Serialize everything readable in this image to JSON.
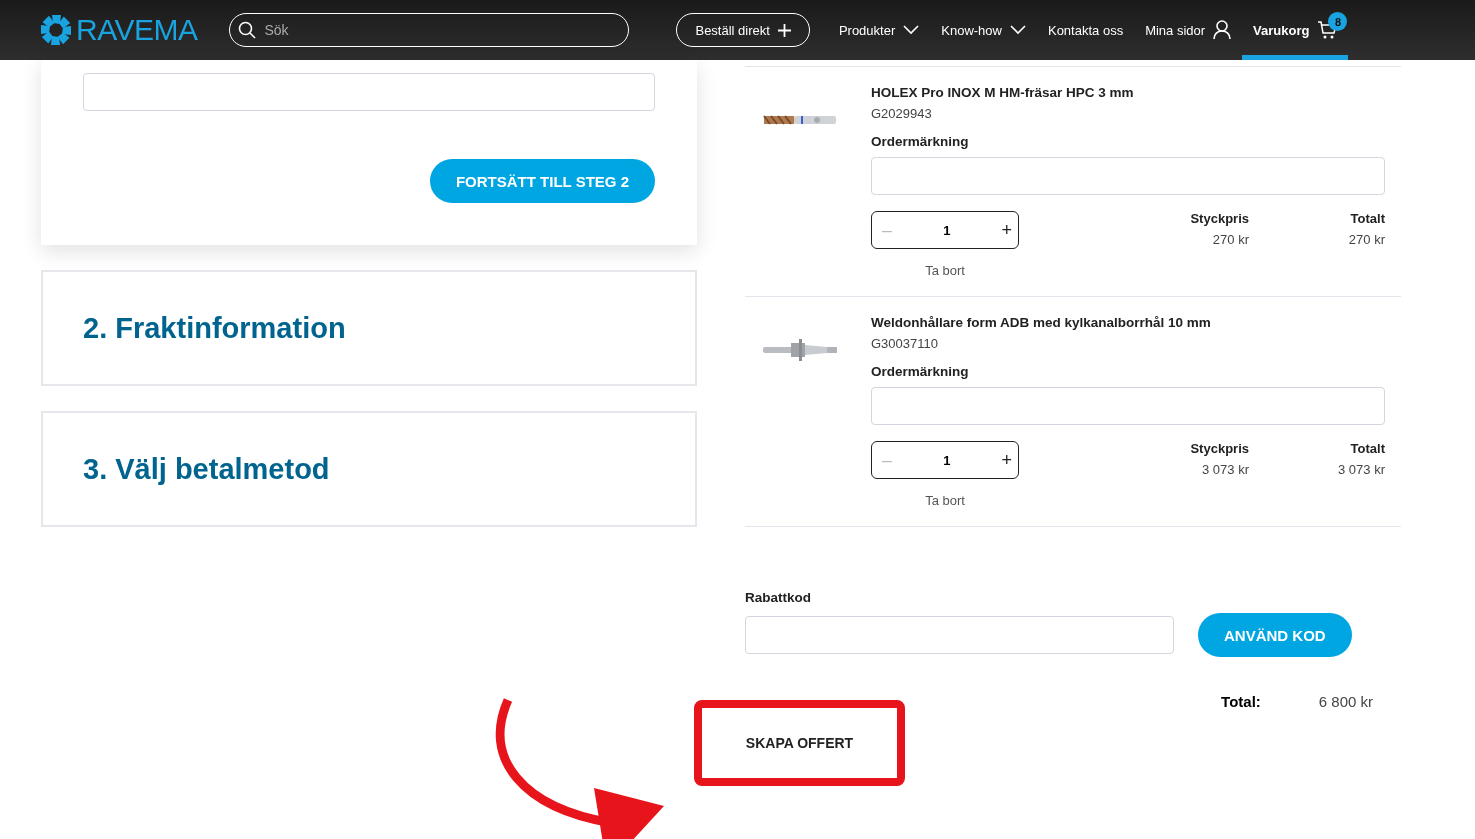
{
  "header": {
    "logo": "RAVEMA",
    "search": {
      "placeholder": "Sök"
    },
    "order_button": "Beställ direkt",
    "nav": [
      {
        "label": "Produkter",
        "kind": "dropdown",
        "selected": false
      },
      {
        "label": "Know-how",
        "kind": "dropdown",
        "selected": false
      },
      {
        "label": "Kontakta oss",
        "kind": "link",
        "selected": false
      },
      {
        "label": "Mina sidor",
        "kind": "account",
        "selected": false
      },
      {
        "label": "Varukorg",
        "kind": "cart",
        "selected": true,
        "badge": "8"
      }
    ]
  },
  "checkout": {
    "continue_button": "FORTSÄTT TILL STEG 2",
    "steps": [
      {
        "title": "2. Fraktinformation"
      },
      {
        "title": "3. Välj betalmetod"
      }
    ]
  },
  "cart": {
    "items": [
      {
        "name": "HOLEX Pro INOX M HM-fräsar HPC 3 mm",
        "sku": "G2029943",
        "marking_label": "Ordermärkning",
        "quantity": "1",
        "minus": "–",
        "plus": "+",
        "minus_disabled": true,
        "unit_price_label": "Styckpris",
        "unit_price": "270 kr",
        "total_label": "Totalt",
        "total": "270 kr",
        "remove": "Ta bort",
        "kind": "mill"
      },
      {
        "name": "Weldonhållare form ADB med kylkanalborrhål 10 mm",
        "sku": "G30037110",
        "marking_label": "Ordermärkning",
        "quantity": "1",
        "minus": "–",
        "plus": "+",
        "minus_disabled": true,
        "unit_price_label": "Styckpris",
        "unit_price": "3 073 kr",
        "total_label": "Totalt",
        "total": "3 073 kr",
        "remove": "Ta bort",
        "kind": "holder"
      }
    ],
    "discount": {
      "label": "Rabattkod",
      "button": "ANVÄND KOD"
    },
    "total": {
      "label": "Total:",
      "value": "6 800 kr"
    },
    "quote_button": "SKAPA OFFERT",
    "quote_highlighted": true
  }
}
